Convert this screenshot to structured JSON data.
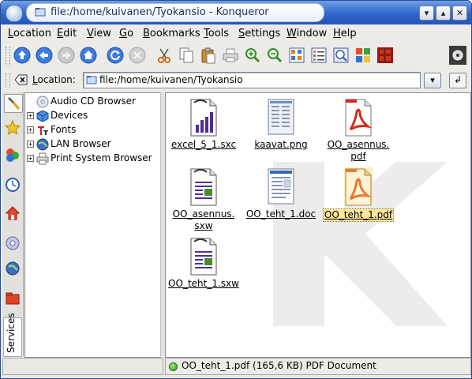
{
  "window": {
    "title": "file:/home/kuivanen/Tyokansio - Konqueror",
    "buttons": {
      "minimize": "▾",
      "maximize": "▴",
      "close": "✕"
    }
  },
  "menubar": {
    "items": [
      {
        "label": "Location",
        "accel": "L",
        "rest": "ocation"
      },
      {
        "label": "Edit",
        "accel": "E",
        "rest": "dit"
      },
      {
        "label": "View",
        "accel": "V",
        "rest": "iew"
      },
      {
        "label": "Go",
        "accel": "G",
        "rest": "o"
      },
      {
        "label": "Bookmarks",
        "accel": "B",
        "rest": "ookmarks"
      },
      {
        "label": "Tools",
        "accel": "T",
        "rest": "ools"
      },
      {
        "label": "Settings",
        "accel": "S",
        "rest": "ettings"
      },
      {
        "label": "Window",
        "accel": "W",
        "rest": "indow"
      },
      {
        "label": "Help",
        "accel": "H",
        "rest": "elp"
      }
    ]
  },
  "toolbar": {
    "icons": [
      "up-arrow-icon",
      "back-icon",
      "forward-icon",
      "home-icon",
      "reload-icon",
      "stop-icon",
      "cut-icon",
      "copy-icon",
      "paste-icon",
      "print-icon",
      "zoom-in-icon",
      "zoom-out-icon",
      "icon-view-icon",
      "detail-view-icon",
      "preview-icon",
      "multicolumn-view-icon",
      "konqueror-logo-icon"
    ]
  },
  "location": {
    "label": "Location:",
    "accel": "L",
    "label_rest": "ocation:",
    "value": "file:/home/kuivanen/Tyokansio",
    "dropdown_glyph": "▾",
    "go_glyph": "↲"
  },
  "sidebar": {
    "tabs": [
      "configure-icon",
      "bookmarks-star-icon",
      "devices-icon",
      "history-icon",
      "home-folder-icon",
      "network-icon",
      "globe-icon",
      "media-folder-icon"
    ],
    "services_label": "Services",
    "tree": [
      {
        "label": "Audio CD Browser",
        "icon": "audio-cd-icon",
        "expand": ""
      },
      {
        "label": "Devices",
        "icon": "devices-cube-icon",
        "expand": "+"
      },
      {
        "label": "Fonts",
        "icon": "fonts-icon",
        "expand": "+"
      },
      {
        "label": "LAN Browser",
        "icon": "lan-icon",
        "expand": "+"
      },
      {
        "label": "Print System Browser",
        "icon": "printer-icon",
        "expand": "+"
      }
    ]
  },
  "files": [
    {
      "line1": "excel_5_1.sxc",
      "line2": "",
      "icon": "spreadsheet-icon",
      "selected": false
    },
    {
      "line1": "kaavat.png",
      "line2": "",
      "icon": "image-icon",
      "selected": false
    },
    {
      "line1": "OO_asennus.",
      "line2": "pdf",
      "icon": "pdf-icon",
      "selected": false
    },
    {
      "line1": "OO_asennus.",
      "line2": "sxw",
      "icon": "writer-doc-icon",
      "selected": false
    },
    {
      "line1": "OO_teht_1.doc",
      "line2": "",
      "icon": "word-doc-icon",
      "selected": false
    },
    {
      "line1": "OO_teht_1.pdf",
      "line2": "",
      "icon": "pdf-icon",
      "selected": true
    },
    {
      "line1": "OO_teht_1.sxw",
      "line2": "",
      "icon": "writer-doc-icon",
      "selected": false
    }
  ],
  "status": {
    "text": "OO_teht_1.pdf (165,6 KB)  PDF Document"
  },
  "colors": {
    "titlebar": "#2f66c9",
    "selection": "#ffe69a",
    "pdf_red": "#d72b1f"
  }
}
